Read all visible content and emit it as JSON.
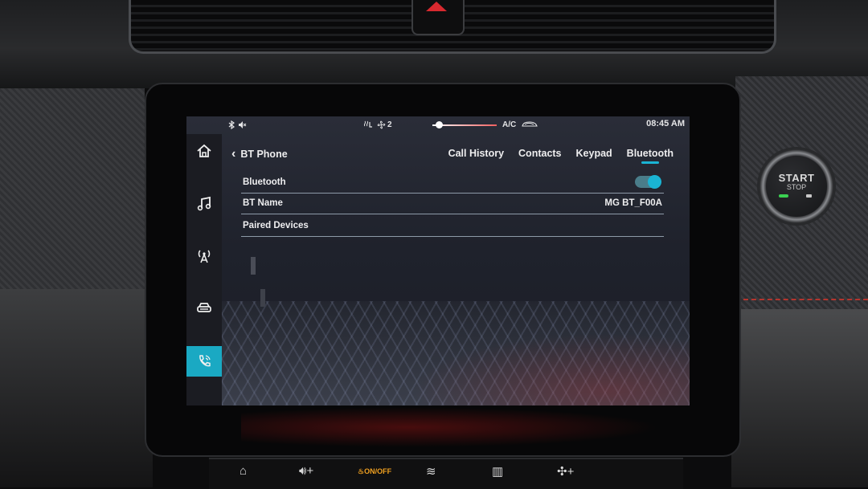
{
  "status_bar": {
    "icons": [
      "bluetooth-icon",
      "mute-icon",
      "seat-heat-icon",
      "fan-icon"
    ],
    "fan_level": "2",
    "temperature_level": 0.1,
    "ac_label": "A/C",
    "time": "08:45 AM"
  },
  "rail": {
    "items": [
      {
        "name": "home",
        "icon": "home-icon"
      },
      {
        "name": "music",
        "icon": "music-note-icon"
      },
      {
        "name": "radio",
        "icon": "antenna-icon"
      },
      {
        "name": "vehicle",
        "icon": "car-icon"
      },
      {
        "name": "phone",
        "icon": "phone-icon",
        "active": true
      }
    ]
  },
  "header": {
    "back_label": "BT Phone",
    "tabs": [
      {
        "label": "Call History"
      },
      {
        "label": "Contacts"
      },
      {
        "label": "Keypad"
      },
      {
        "label": "Bluetooth",
        "active": true
      }
    ]
  },
  "settings": {
    "bluetooth_label": "Bluetooth",
    "bluetooth_on": true,
    "bt_name_label": "BT Name",
    "bt_name_value": "MG BT_F00A",
    "paired_devices_label": "Paired Devices"
  },
  "hardware": {
    "start_label": "START",
    "stop_label": "STOP",
    "onoff_label_top": "ON",
    "onoff_label_bottom": "OFF"
  },
  "colors": {
    "accent": "#1ab4d4",
    "hazard": "#d8292f",
    "stitch": "#b4352e"
  }
}
